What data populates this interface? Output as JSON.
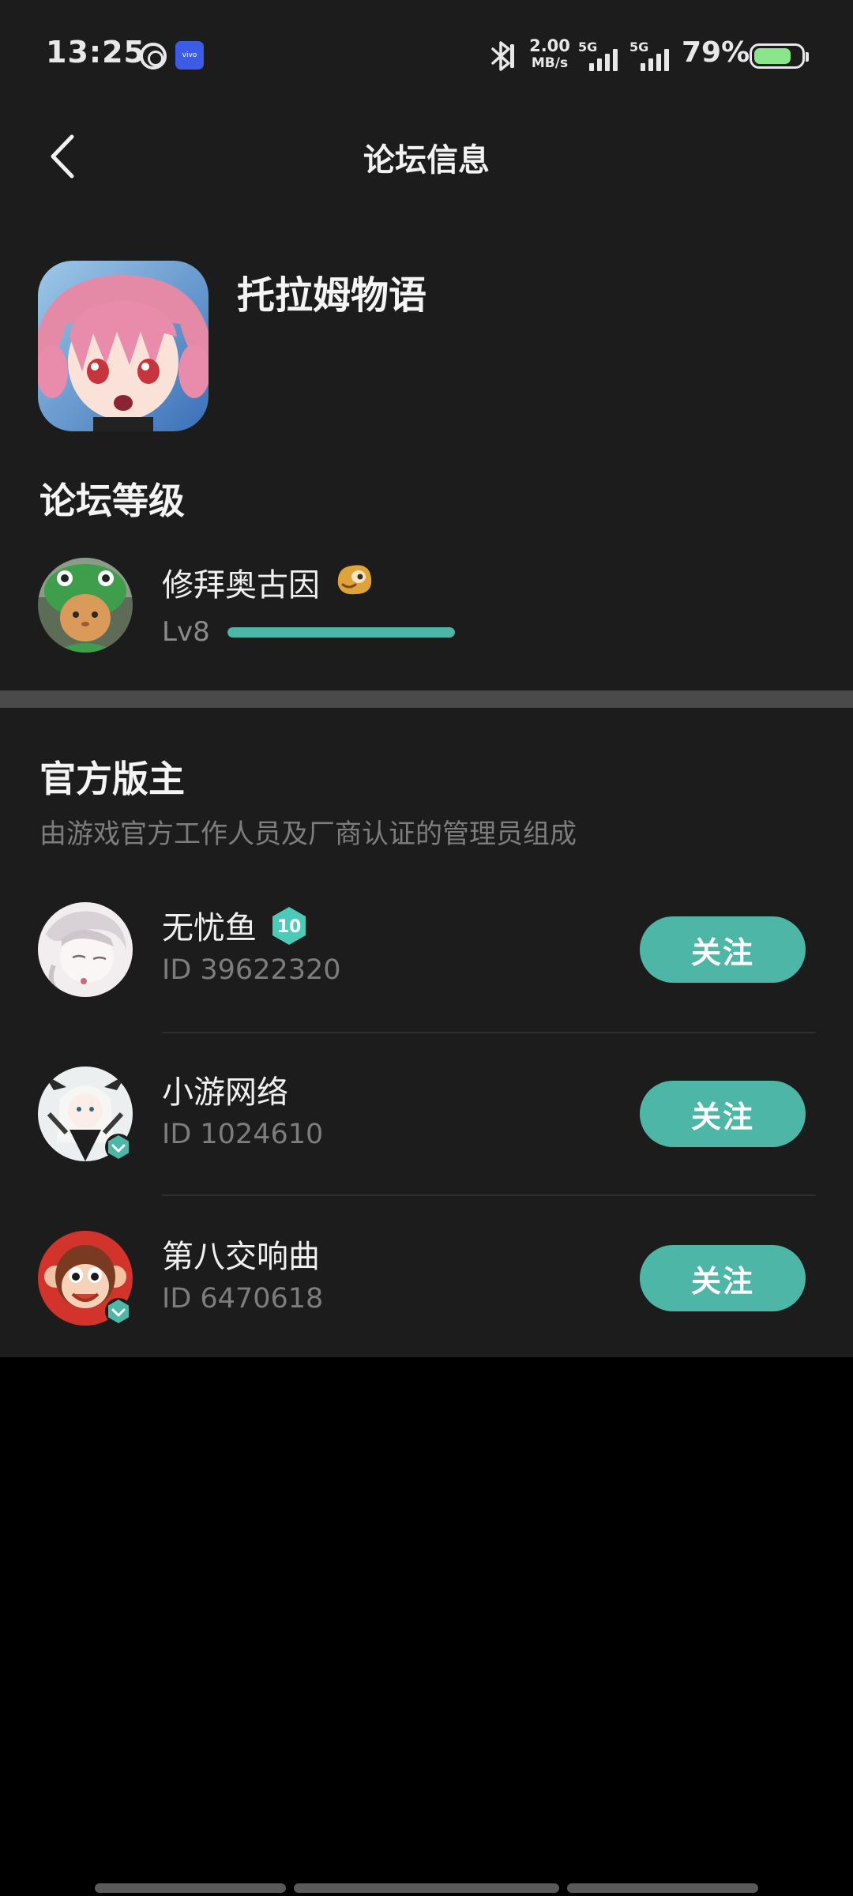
{
  "status_bar": {
    "time": "13:25",
    "carrier_icon": "carrier-ring-icon",
    "vivo_label": "vivo",
    "bluetooth_icon": "bluetooth-icon",
    "net_speed_value": "2.00",
    "net_speed_unit": "MB/s",
    "sim1_label": "5G",
    "sim2_label": "5G",
    "battery_percent": "79%",
    "battery_level": 0.79,
    "battery_color": "#8ae68a"
  },
  "nav": {
    "back_icon": "chevron-left-icon",
    "title": "论坛信息"
  },
  "forum": {
    "name": "托拉姆物语",
    "icon": "forum-anime-icon"
  },
  "level_section": {
    "title": "论坛等级",
    "user_name": "修拜奥古因",
    "medal_icon": "medal-icon",
    "level_text": "Lv8",
    "progress": 1.0,
    "progress_color": "#4db6a6"
  },
  "mods_section": {
    "title": "官方版主",
    "description": "由游戏官方工作人员及厂商认证的管理员组成",
    "moderators": [
      {
        "name": "无忧鱼",
        "id_text": "ID 39622320",
        "badge": "10",
        "follow_label": "关注"
      },
      {
        "name": "小游网络",
        "id_text": "ID 1024610",
        "follow_label": "关注"
      },
      {
        "name": "第八交响曲",
        "id_text": "ID 6470618",
        "follow_label": "关注"
      }
    ]
  },
  "accent_color": "#4db6a6"
}
